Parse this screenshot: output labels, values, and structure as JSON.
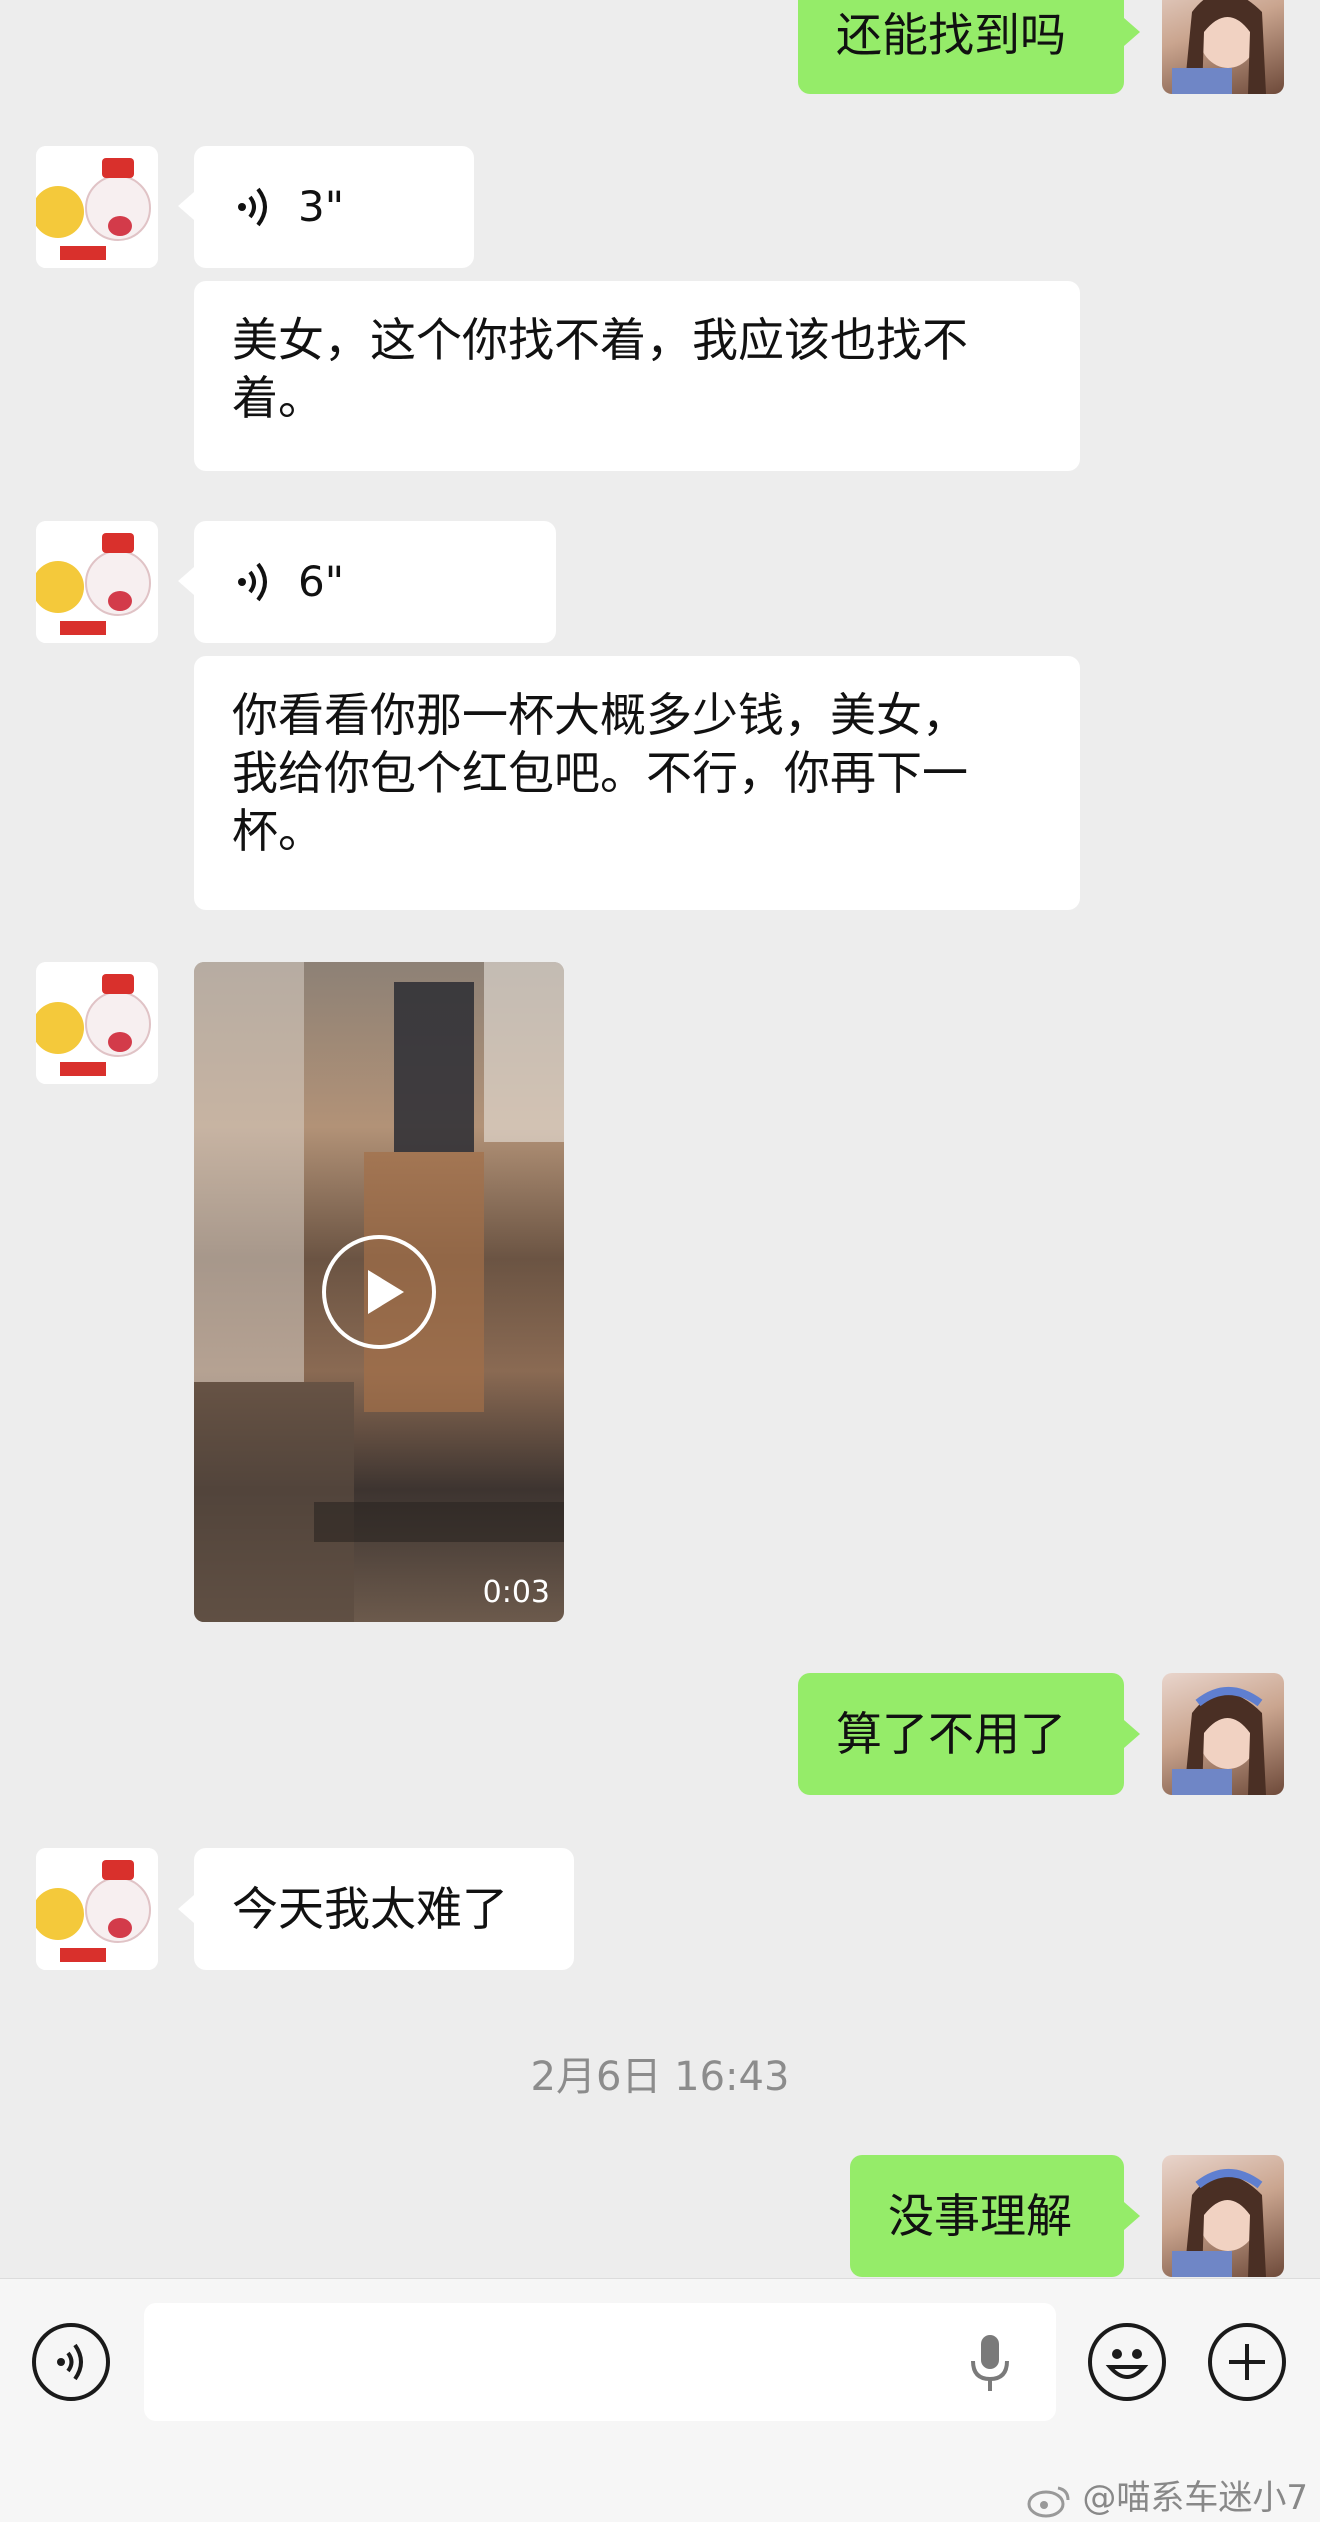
{
  "messages": {
    "m1": {
      "text": "还能找到吗"
    },
    "m2": {
      "duration": "3\""
    },
    "m3": {
      "text": "美女，这个你找不着，我应该也找不\n着。"
    },
    "m4": {
      "duration": "6\""
    },
    "m5": {
      "text": "你看看你那一杯大概多少钱，美女，\n我给你包个红包吧。不行，你再下一\n杯。"
    },
    "m6": {
      "duration": "0:03"
    },
    "m7": {
      "text": "算了不用了"
    },
    "m8": {
      "text": "今天我太难了"
    },
    "m9": {
      "text": "没事理解"
    }
  },
  "timestamp": "2月6日 16:43",
  "watermark": "@喵系车迷小7",
  "colors": {
    "background": "#ededed",
    "sent_bubble": "#95ec69",
    "received_bubble": "#ffffff"
  },
  "icons": [
    "voice-icon",
    "play-icon",
    "microphone-icon",
    "emoji-icon",
    "plus-icon",
    "weibo-icon"
  ]
}
